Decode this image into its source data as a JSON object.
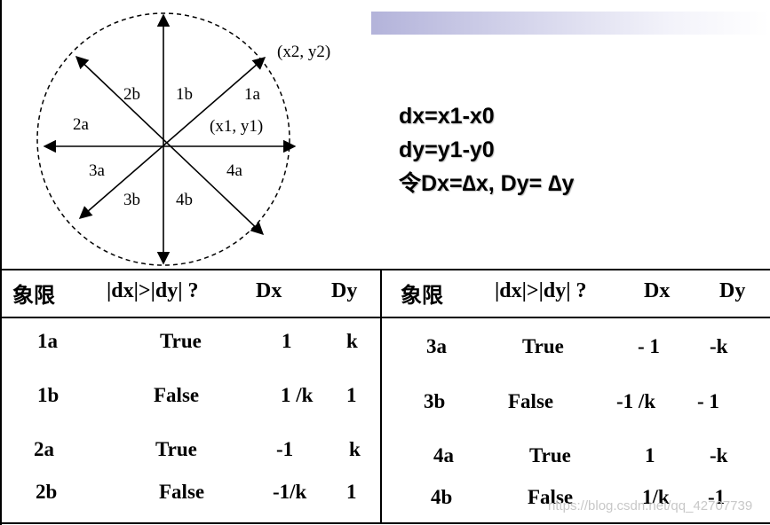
{
  "diagram": {
    "octants": [
      "1a",
      "1b",
      "2a",
      "2b",
      "3a",
      "3b",
      "4a",
      "4b"
    ],
    "point_end": "(x2, y2)",
    "point_start": "(x1, y1)"
  },
  "formulas": [
    "dx=x1-x0",
    "dy=y1-y0",
    "令Dx=∆x, Dy= ∆y"
  ],
  "table": {
    "headers": [
      "象限",
      "|dx|>|dy| ?",
      "Dx",
      "Dy"
    ],
    "left_rows": [
      [
        "1a",
        "True",
        "1",
        "k"
      ],
      [
        "1b",
        "False",
        "1 /k",
        "1"
      ],
      [
        "2a",
        "True",
        "-1",
        "k"
      ],
      [
        "2b",
        "False",
        "-1/k",
        "1"
      ]
    ],
    "right_rows": [
      [
        "3a",
        "True",
        "- 1",
        "-k"
      ],
      [
        "3b",
        "False",
        "-1 /k",
        "- 1"
      ],
      [
        "4a",
        "True",
        "1",
        "-k"
      ],
      [
        "4b",
        "False",
        "1/k",
        "-1"
      ]
    ]
  },
  "watermark": "https://blog.csdn.net/qq_42707739"
}
